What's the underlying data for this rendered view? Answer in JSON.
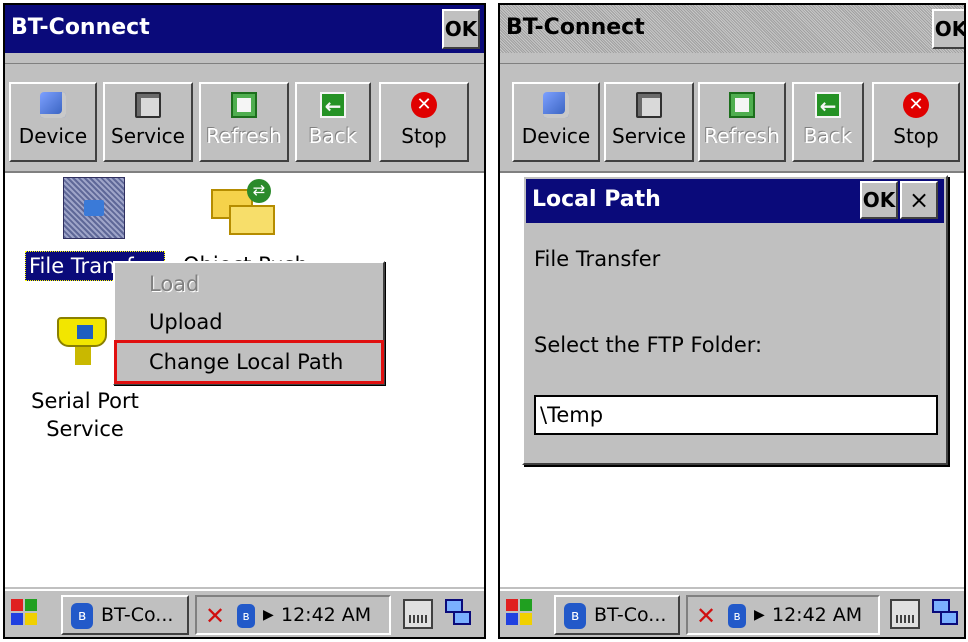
{
  "app": {
    "title": "BT-Connect",
    "ok_label": "OK"
  },
  "toolbar": {
    "device": "Device",
    "service": "Service",
    "refresh": "Refresh",
    "back": "Back",
    "stop": "Stop",
    "back_glyph": "←",
    "stop_glyph": "✕"
  },
  "services": {
    "file_transfer": "File Transfer",
    "object_push": "Object Push",
    "serial_port_line1": "Serial Port",
    "serial_port_line2": "Service"
  },
  "context_menu": {
    "load": "Load",
    "upload": "Upload",
    "change_local_path": "Change Local Path"
  },
  "dialog": {
    "title": "Local Path",
    "ok_label": "OK",
    "close_label": "×",
    "service_name": "File Transfer",
    "prompt": "Select the FTP Folder:",
    "folder_value": "\\Temp"
  },
  "taskbar": {
    "task_label": "BT-Co...",
    "clock": "12:42 AM",
    "bt_glyph": "ʙ",
    "close_glyph": "✕",
    "tray_arrow": "▶"
  },
  "colors": {
    "titlebar": "#0a0a7a",
    "chrome": "#c0c0c0",
    "highlight_outline": "#e01010"
  }
}
